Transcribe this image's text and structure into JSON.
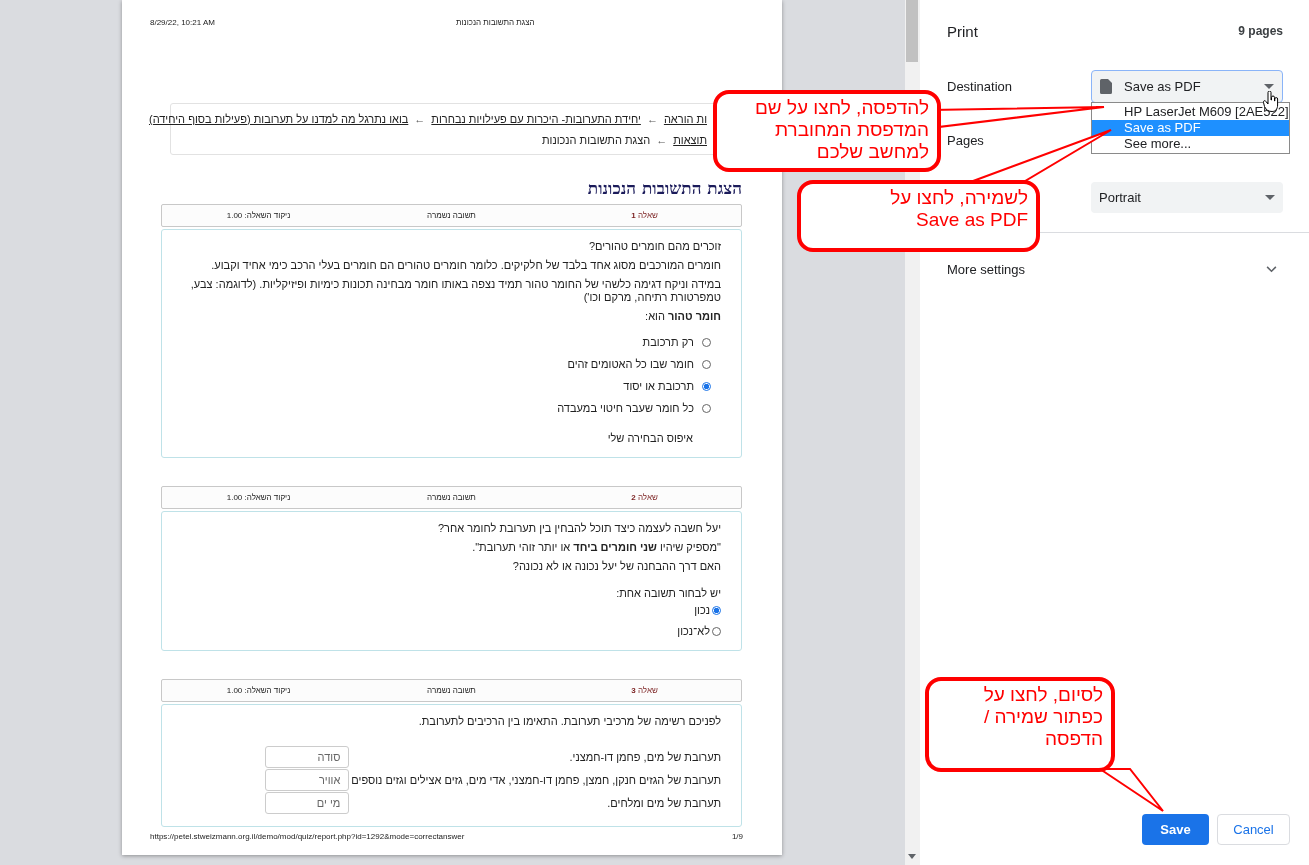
{
  "preview": {
    "header_date": "8/29/22, 10:21 AM",
    "header_title": "הצגת התשובות הנכונות",
    "breadcrumb": [
      [
        {
          "kind": "link",
          "text": "ות הוראה"
        },
        {
          "kind": "separator",
          "text": "←"
        },
        {
          "kind": "link",
          "text": "יחידת התערובות- היכרות עם פעילויות נבחרות"
        },
        {
          "kind": "separator",
          "text": "←"
        },
        {
          "kind": "link",
          "text": "בואו נתרגל מה למדנו על תערובות (פעילות בסוף היחידה)"
        }
      ],
      [
        {
          "kind": "link",
          "text": "תוצאות"
        },
        {
          "kind": "separator",
          "text": "←"
        },
        {
          "kind": "plain",
          "text": "הצגת התשובות הנכונות"
        }
      ]
    ],
    "heading": "הצגת התשובות הנכונות",
    "questions": [
      {
        "title": "שאלה **1**",
        "status": "תשובה נשמרה",
        "score": "ניקוד השאלה: 1.00",
        "paragraphs": [
          "זוכרים מהם חומרים טהורים?",
          "חומרים המורכבים מסוג אחד בלבד של חלקיקים. כלומר חומרים טהורים הם חומרים בעלי הרכב כימי אחיד וקבוע.",
          "במידה וניקח דגימה כלשהי של החומר טהור תמיד נצפה באותו חומר מבחינה תכונות כימיות ופיזיקליות. (לדוגמה: צבע, טמפרטורת רתיחה, מרקם וכו')",
          "**חומר טהור** הוא:"
        ],
        "options": [
          {
            "label": "רק תרכובת",
            "selected": false
          },
          {
            "label": "חומר שבו כל האטומים זהים",
            "selected": false
          },
          {
            "label": "תרכובת או יסוד",
            "selected": true
          },
          {
            "label": "כל חומר שעבר חיטוי במעבדה",
            "selected": false
          }
        ],
        "clear_choice": "איפוס הבחירה שלי"
      },
      {
        "title": "שאלה **2**",
        "status": "תשובה נשמרה",
        "score": "ניקוד השאלה: 1.00",
        "paragraphs": [
          "יעל חשבה לעצמה כיצד תוכל להבחין בין תערובת לחומר אחר?",
          "\"מספיק שיהיו **שני חומרים ביחד** או יותר זוהי תערובת\".",
          "האם דרך ההבחנה של יעל נכונה או לא נכונה?"
        ],
        "prompt": "יש לבחור תשובה אחת:",
        "options": [
          {
            "label": "נכון",
            "selected": true
          },
          {
            "label": "לא־נכון",
            "selected": false
          }
        ]
      },
      {
        "title": "שאלה **3**",
        "status": "תשובה נשמרה",
        "score": "ניקוד השאלה: 1.00",
        "paragraphs": [
          "לפניכם רשימה של מרכיבי תערובת. התאימו בין הרכיבים לתערובת."
        ],
        "matches": [
          {
            "text": "תערובת של מים, פחמן דו-חמצני.",
            "value": "סודה"
          },
          {
            "text": "תערובת של הגזים חנקן, חמצן, פחמן דו-חמצני, אדי מים, גזים אצילים וגזים נוספים",
            "value": "אוויר"
          },
          {
            "text": "תערובת של מים ומלחים.",
            "value": "מי ים"
          }
        ]
      }
    ],
    "footer_url": "https://petel.stweizmann.org.il/demo/mod/quiz/report.php?id=1292&mode=correctanswer",
    "page_number": "1/9"
  },
  "print_panel": {
    "title": "Print",
    "page_count": "9 pages",
    "destination": {
      "label": "Destination",
      "value": "Save as PDF",
      "options": [
        {
          "label": "HP LaserJet M609 [2AE522]",
          "selected": false
        },
        {
          "label": "Save as PDF",
          "selected": true
        },
        {
          "label": "See more...",
          "selected": false
        }
      ]
    },
    "pages_label": "Pages",
    "layout_value": "Portrait",
    "more_settings": "More settings",
    "save": "Save",
    "cancel": "Cancel"
  },
  "callouts": [
    {
      "lines": [
        "להדפסה, לחצו על שם",
        "המדפסת המחוברת",
        "למחשב שלכם"
      ]
    },
    {
      "lines": [
        "לשמירה, לחצו על",
        "Save as PDF"
      ]
    },
    {
      "lines": [
        "לסיום, לחצו על",
        "כפתור שמירה /",
        "הדפסה"
      ]
    }
  ]
}
